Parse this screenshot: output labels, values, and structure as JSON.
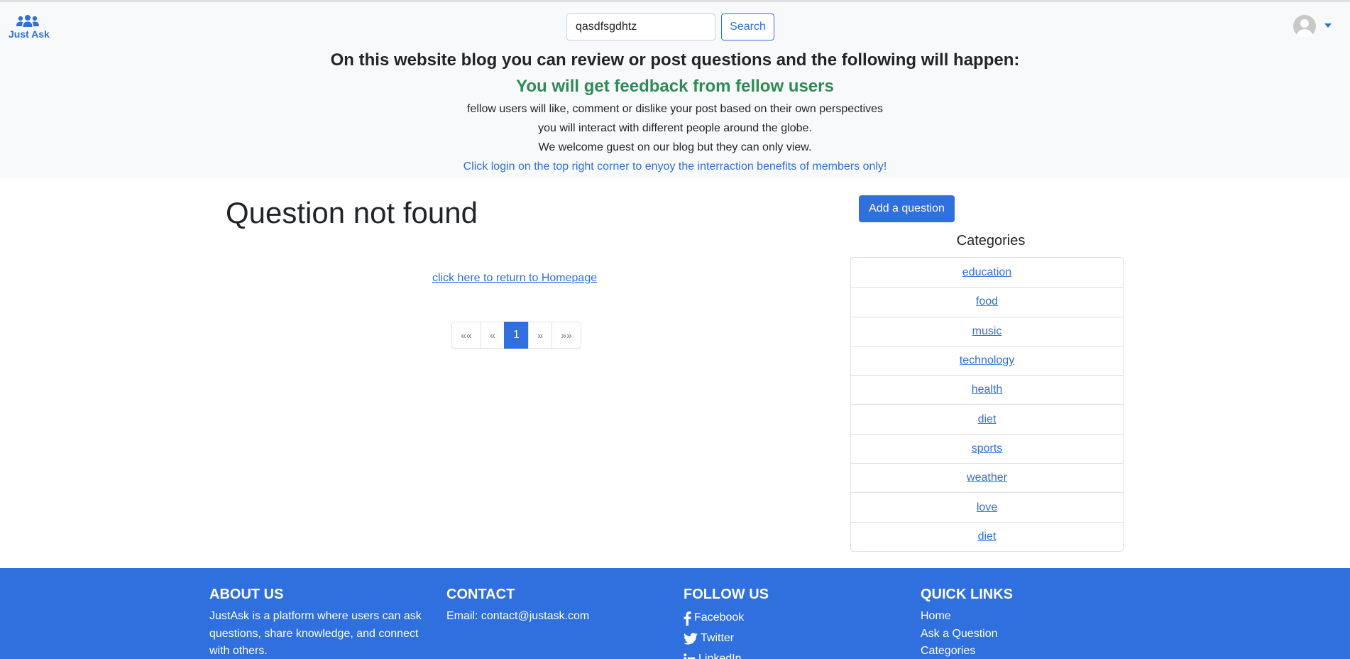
{
  "header": {
    "logo_text": "Just Ask",
    "search": {
      "value": "qasdfsgdhtz",
      "button_label": "Search"
    }
  },
  "hero": {
    "heading": "On this website blog you can review or post questions and the following will happen:",
    "feedback": "You will get feedback from fellow users",
    "lines": [
      "fellow users will like, comment or dislike your post based on their own perspectives",
      "you will interact with different people around the globe.",
      "We welcome guest on our blog but they can only view."
    ],
    "cta": "Click login on the top right corner to enyoy the interraction benefits of members only!"
  },
  "main": {
    "title": "Question not found",
    "home_link": "click here to return to Homepage",
    "pagination": {
      "first": "««",
      "prev": "«",
      "current": "1",
      "next": "»",
      "last": "»»"
    }
  },
  "sidebar": {
    "add_button": "Add a question",
    "categories_title": "Categories",
    "categories": [
      "education",
      "food",
      "music",
      "technology",
      "health",
      "diet",
      "sports",
      "weather",
      "love",
      "diet"
    ]
  },
  "footer": {
    "about": {
      "title": "ABOUT US",
      "text": "JustAsk is a platform where users can ask questions, share knowledge, and connect with others."
    },
    "contact": {
      "title": "CONTACT",
      "email": "Email: contact@justask.com"
    },
    "follow": {
      "title": "FOLLOW US",
      "links": [
        "Facebook",
        "Twitter",
        "LinkedIn"
      ]
    },
    "quick": {
      "title": "QUICK LINKS",
      "links": [
        "Home",
        "Ask a Question",
        "Categories"
      ]
    }
  },
  "colors": {
    "primary": "#2f6fde",
    "success": "#2e8b57",
    "header_bg": "#f8f9fa"
  },
  "icons": {
    "logo": "users-icon",
    "avatar": "user-avatar-icon",
    "facebook": "facebook-icon",
    "twitter": "twitter-icon",
    "linkedin": "linkedin-icon"
  }
}
